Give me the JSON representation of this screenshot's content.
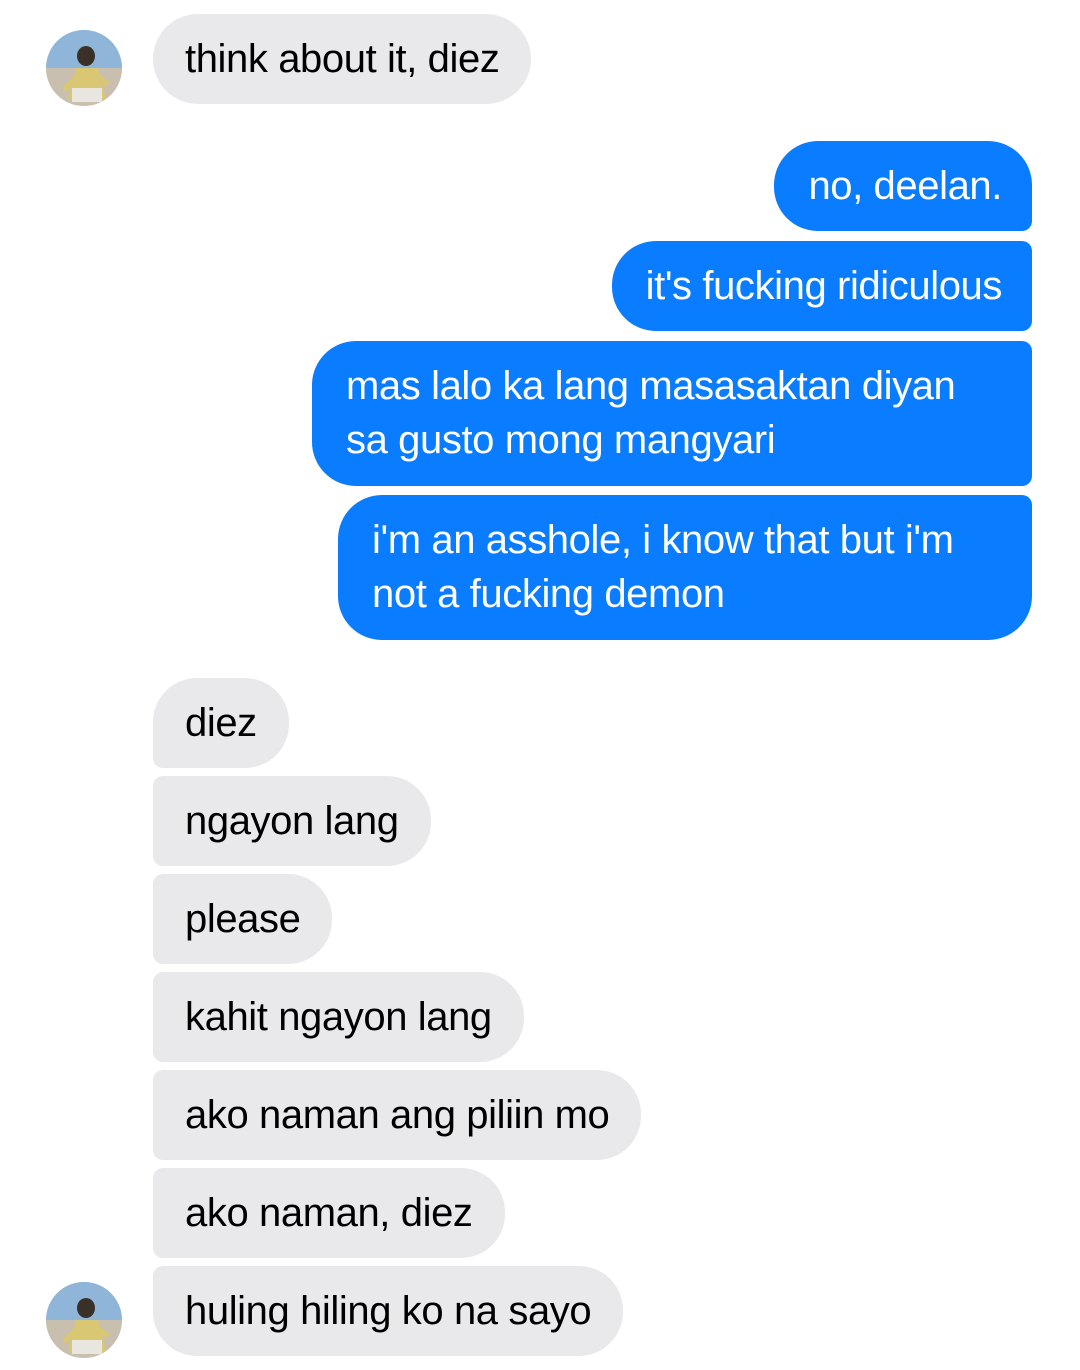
{
  "conversation": {
    "messages": [
      {
        "sender": "them",
        "text": "think about it, diez"
      },
      {
        "sender": "me",
        "text": "no, deelan."
      },
      {
        "sender": "me",
        "text": "it's fucking ridiculous"
      },
      {
        "sender": "me",
        "text": "mas lalo ka lang masasaktan diyan sa gusto mong mangyari"
      },
      {
        "sender": "me",
        "text": "i'm an asshole, i know that but i'm not a fucking demon"
      },
      {
        "sender": "them",
        "text": "diez"
      },
      {
        "sender": "them",
        "text": "ngayon lang"
      },
      {
        "sender": "them",
        "text": "please"
      },
      {
        "sender": "them",
        "text": "kahit ngayon lang"
      },
      {
        "sender": "them",
        "text": "ako naman ang piliin mo"
      },
      {
        "sender": "them",
        "text": "ako naman, diez"
      },
      {
        "sender": "them",
        "text": "huling hiling ko na sayo"
      }
    ]
  },
  "colors": {
    "outgoing_bubble": "#0a7cff",
    "incoming_bubble": "#e9e9eb",
    "outgoing_text": "#ffffff",
    "incoming_text": "#000000"
  },
  "icons": {
    "contact_avatar": "avatar-photo-icon"
  }
}
